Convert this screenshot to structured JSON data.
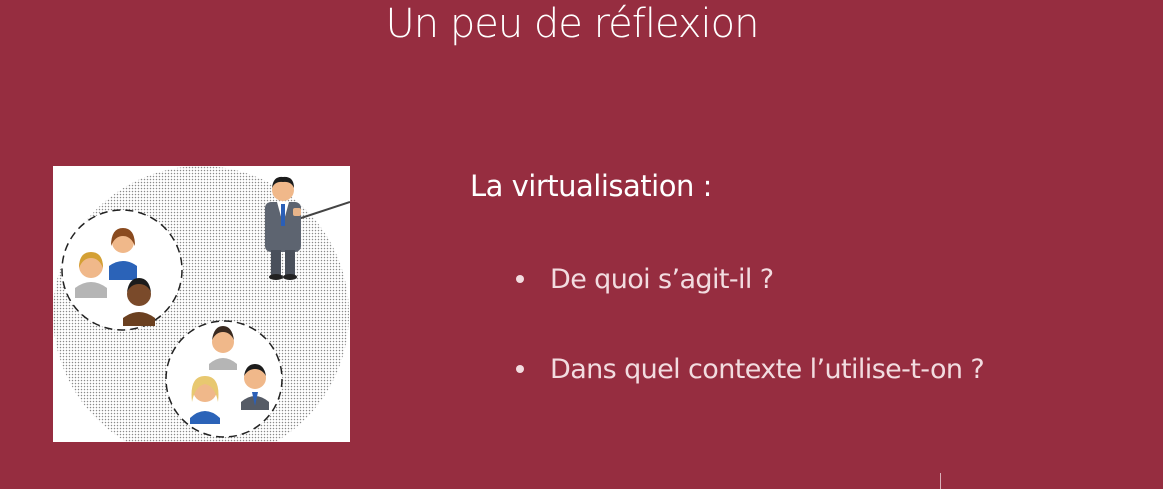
{
  "slide": {
    "title": "Un peu de réflexion",
    "heading": "La virtualisation :",
    "bullets": [
      "De quoi s’agit-il ?",
      "Dans quel contexte l’utilise-t-on ?"
    ]
  },
  "illustration": {
    "icon": "presenter-and-groups-icon"
  },
  "colors": {
    "background": "#962D40",
    "title_text": "#FFFFFF",
    "bullet_text": "#F2DCE0"
  }
}
